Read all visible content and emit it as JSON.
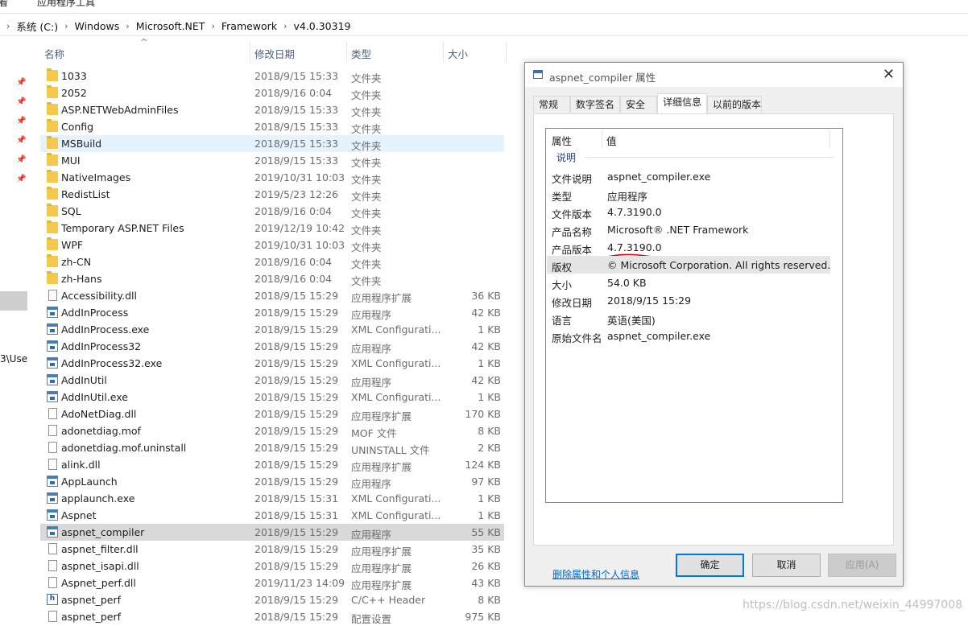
{
  "ribbon": {
    "tab_left": "查看",
    "tab_app": "应用程序工具"
  },
  "address": {
    "crumbs": [
      "系统 (C:)",
      "Windows",
      "Microsoft.NET",
      "Framework",
      "v4.0.30319"
    ]
  },
  "nav": {
    "path_fragment": "3\\Use"
  },
  "columns": {
    "name": "名称",
    "date": "修改日期",
    "type": "类型",
    "size": "大小"
  },
  "files": [
    {
      "name": "1033",
      "date": "2018/9/15 15:33",
      "type": "文件夹",
      "size": "",
      "icon": "folder-icon"
    },
    {
      "name": "2052",
      "date": "2018/9/16 0:04",
      "type": "文件夹",
      "size": "",
      "icon": "folder-icon"
    },
    {
      "name": "ASP.NETWebAdminFiles",
      "date": "2018/9/15 15:33",
      "type": "文件夹",
      "size": "",
      "icon": "folder-icon"
    },
    {
      "name": "Config",
      "date": "2018/9/15 15:33",
      "type": "文件夹",
      "size": "",
      "icon": "folder-icon"
    },
    {
      "name": "MSBuild",
      "date": "2018/9/15 15:33",
      "type": "文件夹",
      "size": "",
      "icon": "folder-icon"
    },
    {
      "name": "MUI",
      "date": "2018/9/15 15:33",
      "type": "文件夹",
      "size": "",
      "icon": "folder-icon"
    },
    {
      "name": "NativeImages",
      "date": "2019/10/31 10:03",
      "type": "文件夹",
      "size": "",
      "icon": "folder-icon"
    },
    {
      "name": "RedistList",
      "date": "2019/5/23 12:26",
      "type": "文件夹",
      "size": "",
      "icon": "folder-icon"
    },
    {
      "name": "SQL",
      "date": "2018/9/16 0:04",
      "type": "文件夹",
      "size": "",
      "icon": "folder-icon"
    },
    {
      "name": "Temporary ASP.NET Files",
      "date": "2019/12/19 10:42",
      "type": "文件夹",
      "size": "",
      "icon": "folder-icon"
    },
    {
      "name": "WPF",
      "date": "2019/10/31 10:03",
      "type": "文件夹",
      "size": "",
      "icon": "folder-icon"
    },
    {
      "name": "zh-CN",
      "date": "2018/9/16 0:04",
      "type": "文件夹",
      "size": "",
      "icon": "folder-icon"
    },
    {
      "name": "zh-Hans",
      "date": "2018/9/16 0:04",
      "type": "文件夹",
      "size": "",
      "icon": "folder-icon"
    },
    {
      "name": "Accessibility.dll",
      "date": "2018/9/15 15:29",
      "type": "应用程序扩展",
      "size": "36 KB",
      "icon": "file-icon"
    },
    {
      "name": "AddInProcess",
      "date": "2018/9/15 15:29",
      "type": "应用程序",
      "size": "42 KB",
      "icon": "exe-icon"
    },
    {
      "name": "AddInProcess.exe",
      "date": "2018/9/15 15:29",
      "type": "XML Configurati...",
      "size": "1 KB",
      "icon": "exe-icon"
    },
    {
      "name": "AddInProcess32",
      "date": "2018/9/15 15:29",
      "type": "应用程序",
      "size": "42 KB",
      "icon": "exe-icon"
    },
    {
      "name": "AddInProcess32.exe",
      "date": "2018/9/15 15:29",
      "type": "XML Configurati...",
      "size": "1 KB",
      "icon": "exe-icon"
    },
    {
      "name": "AddInUtil",
      "date": "2018/9/15 15:29",
      "type": "应用程序",
      "size": "42 KB",
      "icon": "exe-icon"
    },
    {
      "name": "AddInUtil.exe",
      "date": "2018/9/15 15:29",
      "type": "XML Configurati...",
      "size": "1 KB",
      "icon": "exe-icon"
    },
    {
      "name": "AdoNetDiag.dll",
      "date": "2018/9/15 15:29",
      "type": "应用程序扩展",
      "size": "170 KB",
      "icon": "file-icon"
    },
    {
      "name": "adonetdiag.mof",
      "date": "2018/9/15 15:29",
      "type": "MOF 文件",
      "size": "8 KB",
      "icon": "file-icon"
    },
    {
      "name": "adonetdiag.mof.uninstall",
      "date": "2018/9/15 15:29",
      "type": "UNINSTALL 文件",
      "size": "2 KB",
      "icon": "file-icon"
    },
    {
      "name": "alink.dll",
      "date": "2018/9/15 15:29",
      "type": "应用程序扩展",
      "size": "124 KB",
      "icon": "file-icon"
    },
    {
      "name": "AppLaunch",
      "date": "2018/9/15 15:29",
      "type": "应用程序",
      "size": "97 KB",
      "icon": "exe-icon"
    },
    {
      "name": "applaunch.exe",
      "date": "2018/9/15 15:31",
      "type": "XML Configurati...",
      "size": "1 KB",
      "icon": "exe-icon"
    },
    {
      "name": "Aspnet",
      "date": "2018/9/15 15:31",
      "type": "XML Configurati...",
      "size": "1 KB",
      "icon": "exe-icon"
    },
    {
      "name": "aspnet_compiler",
      "date": "2018/9/15 15:29",
      "type": "应用程序",
      "size": "55 KB",
      "icon": "exe-icon"
    },
    {
      "name": "aspnet_filter.dll",
      "date": "2018/9/15 15:29",
      "type": "应用程序扩展",
      "size": "35 KB",
      "icon": "file-icon"
    },
    {
      "name": "aspnet_isapi.dll",
      "date": "2018/9/15 15:29",
      "type": "应用程序扩展",
      "size": "26 KB",
      "icon": "file-icon"
    },
    {
      "name": "Aspnet_perf.dll",
      "date": "2019/11/23 14:09",
      "type": "应用程序扩展",
      "size": "43 KB",
      "icon": "file-icon"
    },
    {
      "name": "aspnet_perf",
      "date": "2018/9/15 15:29",
      "type": "C/C++ Header",
      "size": "8 KB",
      "icon": "header-icon"
    },
    {
      "name": "aspnet_perf",
      "date": "2018/9/15 15:29",
      "type": "配置设置",
      "size": "975 KB",
      "icon": "file-icon"
    }
  ],
  "dialog": {
    "title": "aspnet_compiler 属性",
    "tabs": [
      "常规",
      "数字签名",
      "安全",
      "详细信息",
      "以前的版本"
    ],
    "active_tab": "详细信息",
    "header_property": "属性",
    "header_value": "值",
    "group": "说明",
    "props": [
      {
        "key": "文件说明",
        "value": "aspnet_compiler.exe"
      },
      {
        "key": "类型",
        "value": "应用程序"
      },
      {
        "key": "文件版本",
        "value": "4.7.3190.0"
      },
      {
        "key": "产品名称",
        "value": "Microsoft® .NET Framework"
      },
      {
        "key": "产品版本",
        "value": "4.7.3190.0"
      },
      {
        "key": "版权",
        "value": "© Microsoft Corporation.  All rights reserved."
      },
      {
        "key": "大小",
        "value": "54.0 KB"
      },
      {
        "key": "修改日期",
        "value": "2018/9/15 15:29"
      },
      {
        "key": "语言",
        "value": "英语(美国)"
      },
      {
        "key": "原始文件名",
        "value": "aspnet_compiler.exe"
      }
    ],
    "remove_link": "删除属性和个人信息",
    "ok": "确定",
    "cancel": "取消",
    "apply": "应用(A)"
  },
  "watermark": "https://blog.csdn.net/weixin_44997008",
  "colors": {
    "accent": "#0078d7",
    "link": "#0066cc",
    "folder": "#f4c94b",
    "annotation": "#d9000f"
  }
}
